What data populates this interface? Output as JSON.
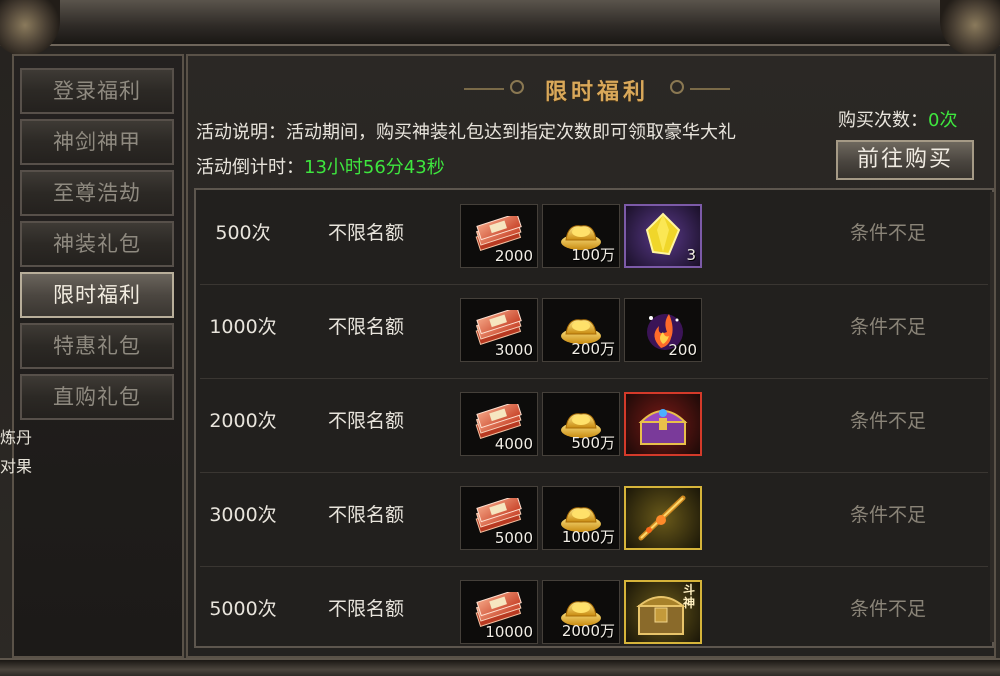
{
  "sidebar": {
    "items": [
      {
        "label": "登录福利",
        "active": false
      },
      {
        "label": "神剑神甲",
        "active": false
      },
      {
        "label": "至尊浩劫",
        "active": false
      },
      {
        "label": "神装礼包",
        "active": false
      },
      {
        "label": "限时福利",
        "active": true
      },
      {
        "label": "特惠礼包",
        "active": false
      },
      {
        "label": "直购礼包",
        "active": false
      }
    ],
    "extra_texts": [
      "炼丹",
      "对果"
    ]
  },
  "header": {
    "title": "限时福利",
    "description_label": "活动说明：",
    "description": "活动期间，购买神装礼包达到指定次数即可领取豪华大礼",
    "countdown_label": "活动倒计时：",
    "countdown": "13小时56分43秒",
    "buy_count_label": "购买次数：",
    "buy_count_value": "0次",
    "goto_button": "前往购买"
  },
  "rows": [
    {
      "times": "500次",
      "limit": "不限名额",
      "items": [
        {
          "icon": "scroll-bundle-icon",
          "qty": "2000",
          "frame": "plain"
        },
        {
          "icon": "gold-ingot-icon",
          "qty": "100万",
          "frame": "plain"
        },
        {
          "icon": "yellow-gem-icon",
          "qty": "3",
          "frame": "purple"
        }
      ],
      "status": "条件不足"
    },
    {
      "times": "1000次",
      "limit": "不限名额",
      "items": [
        {
          "icon": "scroll-bundle-icon",
          "qty": "3000",
          "frame": "plain"
        },
        {
          "icon": "gold-ingot-icon",
          "qty": "200万",
          "frame": "plain"
        },
        {
          "icon": "fire-spark-icon",
          "qty": "200",
          "frame": "plain"
        }
      ],
      "status": "条件不足"
    },
    {
      "times": "2000次",
      "limit": "不限名额",
      "items": [
        {
          "icon": "scroll-bundle-icon",
          "qty": "4000",
          "frame": "plain"
        },
        {
          "icon": "gold-ingot-icon",
          "qty": "500万",
          "frame": "plain"
        },
        {
          "icon": "treasure-chest-icon",
          "qty": "",
          "frame": "red"
        }
      ],
      "status": "条件不足"
    },
    {
      "times": "3000次",
      "limit": "不限名额",
      "items": [
        {
          "icon": "scroll-bundle-icon",
          "qty": "5000",
          "frame": "plain"
        },
        {
          "icon": "gold-ingot-icon",
          "qty": "1000万",
          "frame": "plain"
        },
        {
          "icon": "golden-staff-icon",
          "qty": "",
          "frame": "gold"
        }
      ],
      "status": "条件不足"
    },
    {
      "times": "5000次",
      "limit": "不限名额",
      "items": [
        {
          "icon": "scroll-bundle-icon",
          "qty": "10000",
          "frame": "plain"
        },
        {
          "icon": "gold-ingot-icon",
          "qty": "2000万",
          "frame": "plain"
        },
        {
          "icon": "battle-chest-icon",
          "qty": "",
          "frame": "gold",
          "emblem": "斗神"
        }
      ],
      "status": "条件不足"
    }
  ]
}
